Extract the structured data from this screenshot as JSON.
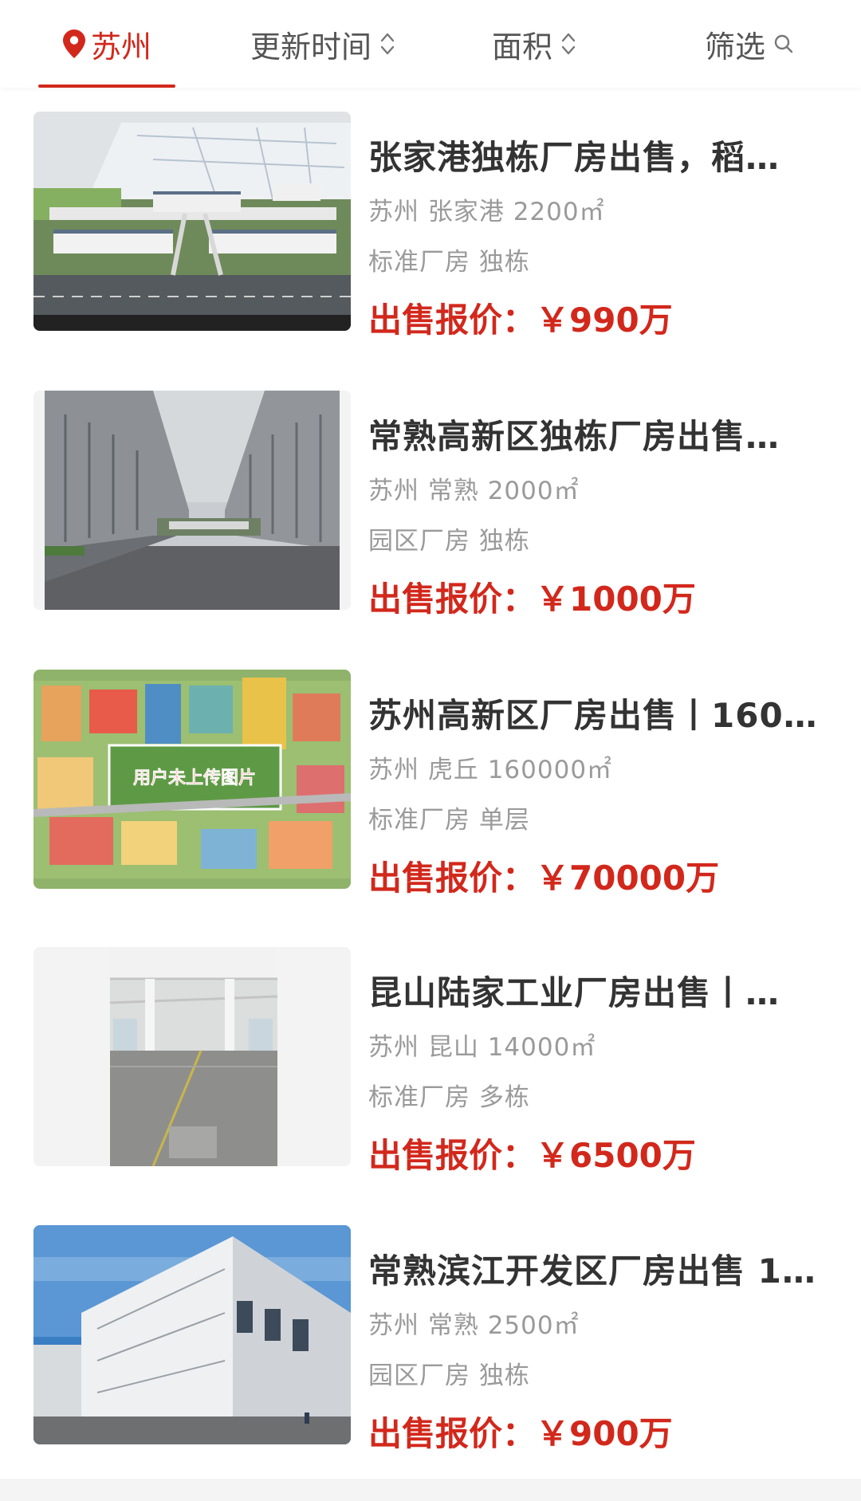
{
  "filters": {
    "city": "苏州",
    "update_time": "更新时间",
    "area": "面积",
    "filter": "筛选"
  },
  "listings": [
    {
      "title": "张家港独栋厂房出售，稻…",
      "location": "苏州 张家港 2200㎡",
      "tags": "标准厂房 独栋",
      "price": "出售报价：￥990万",
      "image": "factory-park-model-photo"
    },
    {
      "title": "常熟高新区独栋厂房出售…",
      "location": "苏州 常熟 2000㎡",
      "tags": "园区厂房 独栋",
      "price": "出售报价：￥1000万",
      "image": "industrial-park-street-photo"
    },
    {
      "title": "苏州高新区厂房出售丨160…",
      "location": "苏州 虎丘 160000㎡",
      "tags": "标准厂房 单层",
      "price": "出售报价：￥70000万",
      "image": "placeholder-city-illustration",
      "image_caption": "用户未上传图片"
    },
    {
      "title": "昆山陆家工业厂房出售丨…",
      "location": "苏州 昆山 14000㎡",
      "tags": "标准厂房 多栋",
      "price": "出售报价：￥6500万",
      "image": "empty-factory-interior-photo"
    },
    {
      "title": "常熟滨江开发区厂房出售 1…",
      "location": "苏州 常熟 2500㎡",
      "tags": "园区厂房 独栋",
      "price": "出售报价：￥900万",
      "image": "white-factory-building-photo"
    }
  ],
  "colors": {
    "accent": "#d2281c",
    "title": "#333333",
    "meta": "#9a9a9a",
    "tab": "#555555"
  }
}
